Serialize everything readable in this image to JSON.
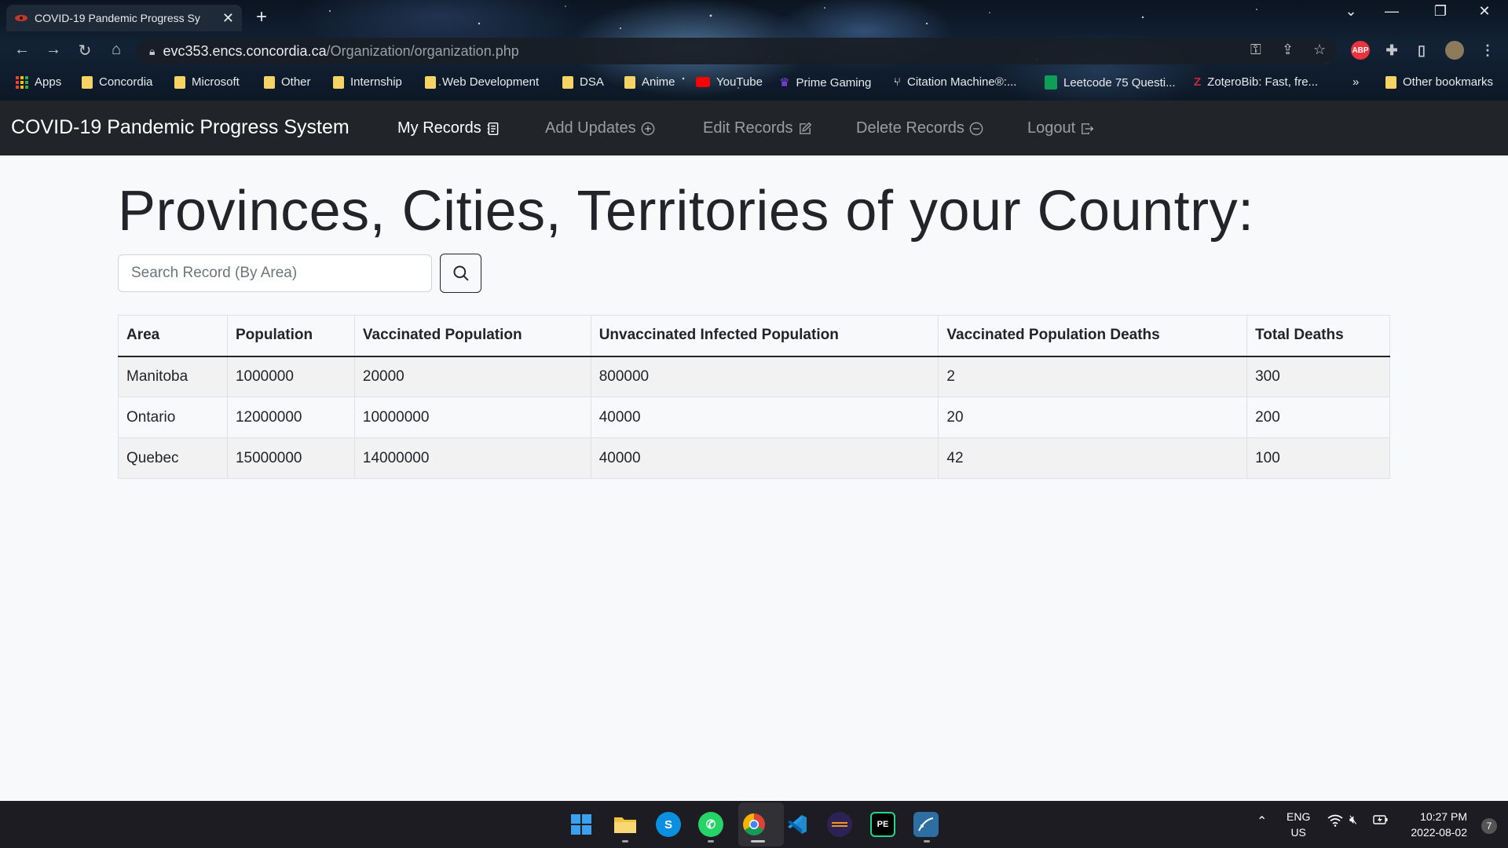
{
  "browser": {
    "tab_title": "COVID-19 Pandemic Progress Sy",
    "url_host": "evc353.encs.concordia.ca",
    "url_path": "/Organization/organization.php",
    "bookmarks": [
      "Apps",
      "Concordia",
      "Microsoft",
      "Other",
      "Internship",
      "Web Development",
      "DSA",
      "Anime",
      "YouTube",
      "Prime Gaming",
      "Citation Machine®:...",
      "Leetcode 75 Questi...",
      "ZoteroBib: Fast, fre...",
      "Other bookmarks"
    ],
    "overflow_label": "»",
    "extension_label": "ABP"
  },
  "navbar": {
    "brand": "COVID-19 Pandemic Progress System",
    "links": [
      {
        "label": "My Records",
        "icon": "journal-text-icon",
        "active": true
      },
      {
        "label": "Add Updates",
        "icon": "plus-circle-icon",
        "active": false
      },
      {
        "label": "Edit Records",
        "icon": "pencil-square-icon",
        "active": false
      },
      {
        "label": "Delete Records",
        "icon": "dash-circle-icon",
        "active": false
      },
      {
        "label": "Logout",
        "icon": "box-arrow-right-icon",
        "active": false
      }
    ]
  },
  "main": {
    "title": "Provinces, Cities, Territories of your Country:",
    "search_placeholder": "Search Record (By Area)",
    "search_value": ""
  },
  "table": {
    "headers": [
      "Area",
      "Population",
      "Vaccinated Population",
      "Unvaccinated Infected Population",
      "Vaccinated Population Deaths",
      "Total Deaths"
    ],
    "rows": [
      [
        "Manitoba",
        "1000000",
        "20000",
        "800000",
        "2",
        "300"
      ],
      [
        "Ontario",
        "12000000",
        "10000000",
        "40000",
        "20",
        "200"
      ],
      [
        "Quebec",
        "15000000",
        "14000000",
        "40000",
        "42",
        "100"
      ]
    ]
  },
  "taskbar": {
    "lang_top": "ENG",
    "lang_bottom": "US",
    "time": "10:27 PM",
    "date": "2022-08-02",
    "notifications": "7",
    "apps": [
      "windows-start-icon",
      "file-explorer-icon",
      "skype-icon",
      "whatsapp-icon",
      "chrome-icon",
      "vscode-icon",
      "eclipse-icon",
      "pycharm-edu-icon",
      "mysql-workbench-icon"
    ]
  },
  "colors": {
    "navbar_bg": "#212529",
    "page_bg": "#f8f9fa",
    "text": "#212529"
  }
}
